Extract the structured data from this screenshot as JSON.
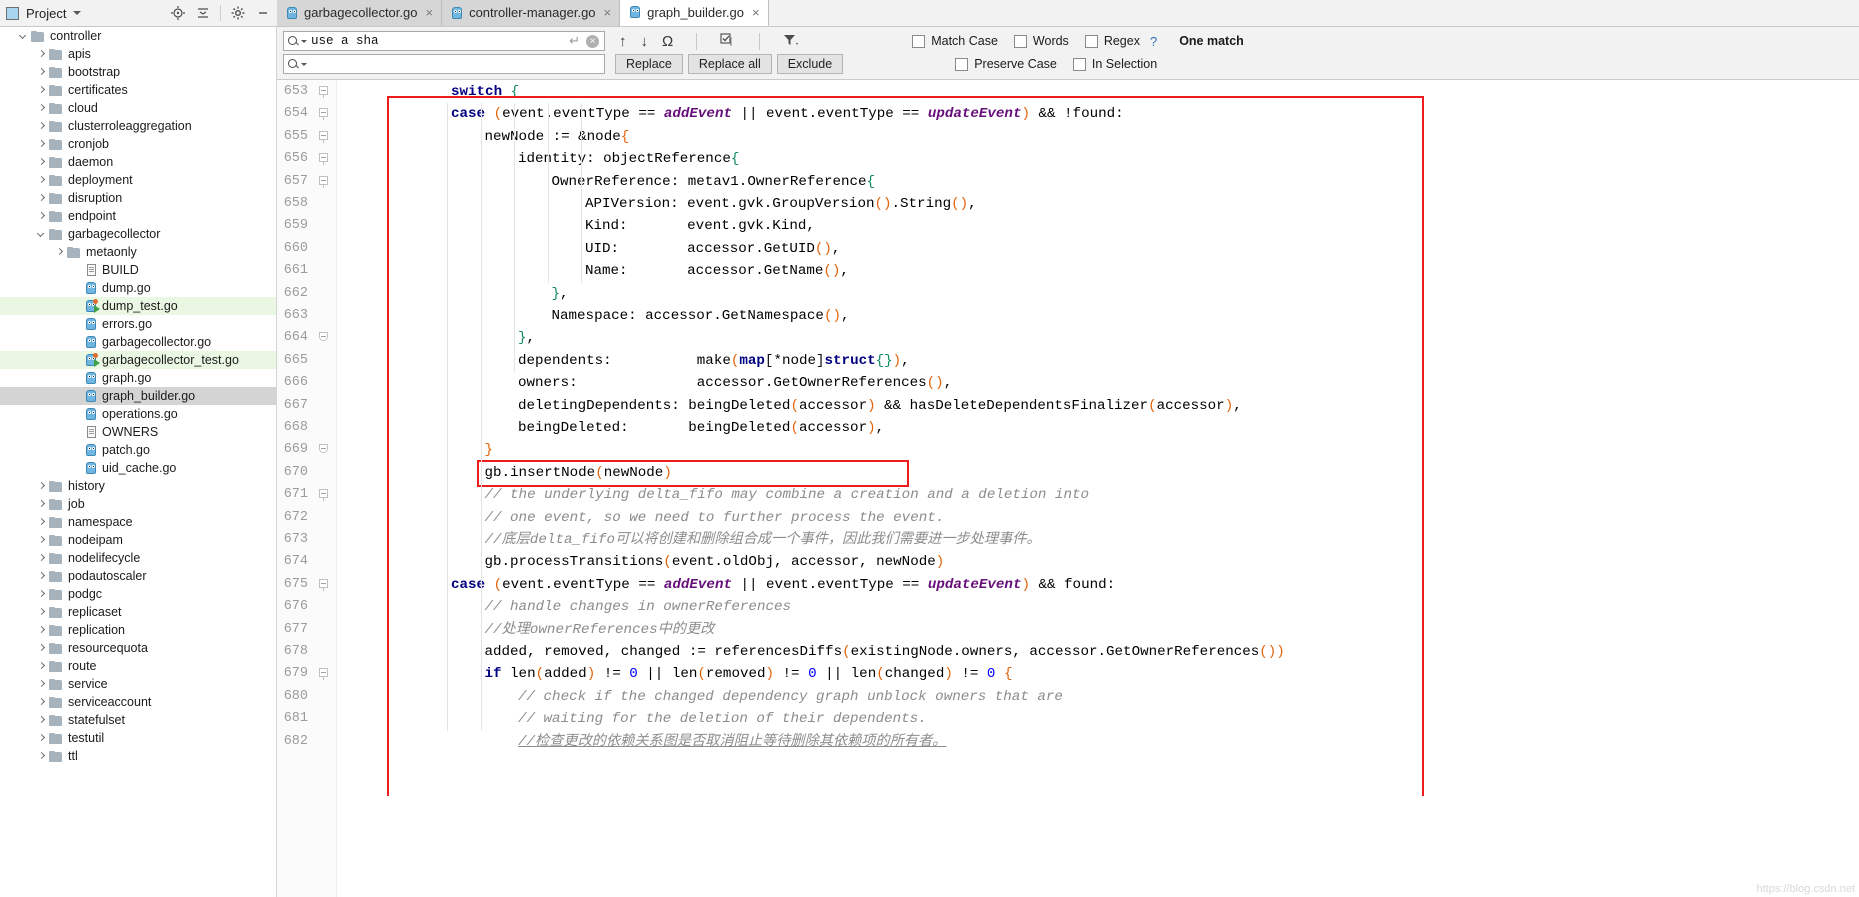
{
  "project_panel": {
    "title": "Project",
    "icon": "project-icon",
    "tools": [
      "locate-icon",
      "collapse-all-icon",
      "settings-gear-icon",
      "minimize-icon"
    ],
    "items": [
      {
        "label": "controller",
        "depth": 1,
        "type": "folder",
        "state": "expanded"
      },
      {
        "label": "apis",
        "depth": 2,
        "type": "folder",
        "state": "collapsed"
      },
      {
        "label": "bootstrap",
        "depth": 2,
        "type": "folder",
        "state": "collapsed"
      },
      {
        "label": "certificates",
        "depth": 2,
        "type": "folder",
        "state": "collapsed"
      },
      {
        "label": "cloud",
        "depth": 2,
        "type": "folder",
        "state": "collapsed"
      },
      {
        "label": "clusterroleaggregation",
        "depth": 2,
        "type": "folder",
        "state": "collapsed"
      },
      {
        "label": "cronjob",
        "depth": 2,
        "type": "folder",
        "state": "collapsed"
      },
      {
        "label": "daemon",
        "depth": 2,
        "type": "folder",
        "state": "collapsed"
      },
      {
        "label": "deployment",
        "depth": 2,
        "type": "folder",
        "state": "collapsed"
      },
      {
        "label": "disruption",
        "depth": 2,
        "type": "folder",
        "state": "collapsed"
      },
      {
        "label": "endpoint",
        "depth": 2,
        "type": "folder",
        "state": "collapsed"
      },
      {
        "label": "garbagecollector",
        "depth": 2,
        "type": "folder",
        "state": "expanded"
      },
      {
        "label": "metaonly",
        "depth": 3,
        "type": "folder",
        "state": "collapsed"
      },
      {
        "label": "BUILD",
        "depth": 4,
        "type": "text"
      },
      {
        "label": "dump.go",
        "depth": 4,
        "type": "go"
      },
      {
        "label": "dump_test.go",
        "depth": 4,
        "type": "gotest",
        "highlight": "green"
      },
      {
        "label": "errors.go",
        "depth": 4,
        "type": "go"
      },
      {
        "label": "garbagecollector.go",
        "depth": 4,
        "type": "go"
      },
      {
        "label": "garbagecollector_test.go",
        "depth": 4,
        "type": "gotest",
        "highlight": "green"
      },
      {
        "label": "graph.go",
        "depth": 4,
        "type": "go"
      },
      {
        "label": "graph_builder.go",
        "depth": 4,
        "type": "go",
        "highlight": "selected"
      },
      {
        "label": "operations.go",
        "depth": 4,
        "type": "go"
      },
      {
        "label": "OWNERS",
        "depth": 4,
        "type": "text"
      },
      {
        "label": "patch.go",
        "depth": 4,
        "type": "go"
      },
      {
        "label": "uid_cache.go",
        "depth": 4,
        "type": "go"
      },
      {
        "label": "history",
        "depth": 2,
        "type": "folder",
        "state": "collapsed"
      },
      {
        "label": "job",
        "depth": 2,
        "type": "folder",
        "state": "collapsed"
      },
      {
        "label": "namespace",
        "depth": 2,
        "type": "folder",
        "state": "collapsed"
      },
      {
        "label": "nodeipam",
        "depth": 2,
        "type": "folder",
        "state": "collapsed"
      },
      {
        "label": "nodelifecycle",
        "depth": 2,
        "type": "folder",
        "state": "collapsed"
      },
      {
        "label": "podautoscaler",
        "depth": 2,
        "type": "folder",
        "state": "collapsed"
      },
      {
        "label": "podgc",
        "depth": 2,
        "type": "folder",
        "state": "collapsed"
      },
      {
        "label": "replicaset",
        "depth": 2,
        "type": "folder",
        "state": "collapsed"
      },
      {
        "label": "replication",
        "depth": 2,
        "type": "folder",
        "state": "collapsed"
      },
      {
        "label": "resourcequota",
        "depth": 2,
        "type": "folder",
        "state": "collapsed"
      },
      {
        "label": "route",
        "depth": 2,
        "type": "folder",
        "state": "collapsed"
      },
      {
        "label": "service",
        "depth": 2,
        "type": "folder",
        "state": "collapsed"
      },
      {
        "label": "serviceaccount",
        "depth": 2,
        "type": "folder",
        "state": "collapsed"
      },
      {
        "label": "statefulset",
        "depth": 2,
        "type": "folder",
        "state": "collapsed"
      },
      {
        "label": "testutil",
        "depth": 2,
        "type": "folder",
        "state": "collapsed"
      },
      {
        "label": "ttl",
        "depth": 2,
        "type": "folder",
        "state": "collapsed"
      }
    ]
  },
  "tabs": [
    {
      "label": "garbagecollector.go",
      "active": false,
      "icon": "go-file-icon",
      "close": "×"
    },
    {
      "label": "controller-manager.go",
      "active": false,
      "icon": "go-file-icon",
      "close": "×"
    },
    {
      "label": "graph_builder.go",
      "active": true,
      "icon": "go-file-icon",
      "close": "×"
    }
  ],
  "find_panel": {
    "search_value": "use a sha",
    "search_placeholder": "",
    "replace_value": "",
    "replace_placeholder": "",
    "enter_icon": "↵",
    "clear_icon": "×",
    "prev_icon": "↑",
    "next_icon": "↓",
    "regex_omega_icon": "Ω",
    "select_all_icon": "select-all-icon",
    "filter_icon": "filter-icon",
    "buttons": [
      "Replace",
      "Replace all",
      "Exclude"
    ],
    "checkboxes_row1": [
      {
        "label": "Match Case",
        "accel": "C",
        "checked": false
      },
      {
        "label": "Words",
        "accel": "o",
        "checked": false
      },
      {
        "label": "Regex",
        "accel": "x",
        "checked": false
      }
    ],
    "checkboxes_row2": [
      {
        "label": "Preserve Case",
        "accel": "",
        "checked": false
      },
      {
        "label": "In Selection",
        "accel": "",
        "checked": false
      }
    ],
    "help_icon": "?",
    "match_info": "One match"
  },
  "editor": {
    "first_line": 653,
    "lines": [
      {
        "n": 653,
        "indent": 0,
        "fold": "start",
        "tokens": [
          {
            "t": "switch ",
            "c": "kw"
          },
          {
            "t": "{",
            "c": "brc"
          }
        ]
      },
      {
        "n": 654,
        "indent": 0,
        "fold": "start",
        "tokens": [
          {
            "t": "case ",
            "c": "kw"
          },
          {
            "t": "(",
            "c": "par"
          },
          {
            "t": "event.eventType == ",
            "c": "ident"
          },
          {
            "t": "addEvent",
            "c": "it"
          },
          {
            "t": " || ",
            "c": "ident"
          },
          {
            "t": "event.eventType == ",
            "c": "ident"
          },
          {
            "t": "updateEvent",
            "c": "it"
          },
          {
            "t": ")",
            "c": "par"
          },
          {
            "t": " && !found:",
            "c": "ident"
          }
        ]
      },
      {
        "n": 655,
        "indent": 1,
        "fold": "start",
        "tokens": [
          {
            "t": "newNode := &node",
            "c": "ident"
          },
          {
            "t": "{",
            "c": "par"
          }
        ]
      },
      {
        "n": 656,
        "indent": 2,
        "fold": "start",
        "tokens": [
          {
            "t": "identity: objectReference",
            "c": "ident"
          },
          {
            "t": "{",
            "c": "brc"
          }
        ]
      },
      {
        "n": 657,
        "indent": 3,
        "fold": "start",
        "tokens": [
          {
            "t": "OwnerReference: metav1.OwnerReference",
            "c": "ident"
          },
          {
            "t": "{",
            "c": "brc"
          }
        ]
      },
      {
        "n": 658,
        "indent": 4,
        "fold": "",
        "tokens": [
          {
            "t": "APIVersion: event.gvk.GroupVersion",
            "c": "ident"
          },
          {
            "t": "()",
            "c": "par"
          },
          {
            "t": ".String",
            "c": "ident"
          },
          {
            "t": "()",
            "c": "par"
          },
          {
            "t": ",",
            "c": "ident"
          }
        ]
      },
      {
        "n": 659,
        "indent": 4,
        "fold": "",
        "tokens": [
          {
            "t": "Kind:       event.gvk.Kind,",
            "c": "ident"
          }
        ]
      },
      {
        "n": 660,
        "indent": 4,
        "fold": "",
        "tokens": [
          {
            "t": "UID:        accessor.GetUID",
            "c": "ident"
          },
          {
            "t": "()",
            "c": "par"
          },
          {
            "t": ",",
            "c": "ident"
          }
        ]
      },
      {
        "n": 661,
        "indent": 4,
        "fold": "",
        "tokens": [
          {
            "t": "Name:       accessor.GetName",
            "c": "ident"
          },
          {
            "t": "()",
            "c": "par"
          },
          {
            "t": ",",
            "c": "ident"
          }
        ]
      },
      {
        "n": 662,
        "indent": 3,
        "fold": "",
        "tokens": [
          {
            "t": "}",
            "c": "brc"
          },
          {
            "t": ",",
            "c": "ident"
          }
        ]
      },
      {
        "n": 663,
        "indent": 3,
        "fold": "",
        "tokens": [
          {
            "t": "Namespace: accessor.GetNamespace",
            "c": "ident"
          },
          {
            "t": "()",
            "c": "par"
          },
          {
            "t": ",",
            "c": "ident"
          }
        ]
      },
      {
        "n": 664,
        "indent": 2,
        "fold": "end",
        "tokens": [
          {
            "t": "}",
            "c": "brc"
          },
          {
            "t": ",",
            "c": "ident"
          }
        ]
      },
      {
        "n": 665,
        "indent": 2,
        "fold": "",
        "tokens": [
          {
            "t": "dependents:          make",
            "c": "ident"
          },
          {
            "t": "(",
            "c": "par"
          },
          {
            "t": "map",
            "c": "kw"
          },
          {
            "t": "[",
            "c": "brk"
          },
          {
            "t": "*node",
            "c": "ident"
          },
          {
            "t": "]",
            "c": "brk"
          },
          {
            "t": "struct",
            "c": "kw"
          },
          {
            "t": "{}",
            "c": "brc"
          },
          {
            "t": ")",
            "c": "par"
          },
          {
            "t": ",",
            "c": "ident"
          }
        ]
      },
      {
        "n": 666,
        "indent": 2,
        "fold": "",
        "tokens": [
          {
            "t": "owners:              accessor.GetOwnerReferences",
            "c": "ident"
          },
          {
            "t": "()",
            "c": "par"
          },
          {
            "t": ",",
            "c": "ident"
          }
        ]
      },
      {
        "n": 667,
        "indent": 2,
        "fold": "",
        "tokens": [
          {
            "t": "deletingDependents: beingDeleted",
            "c": "ident"
          },
          {
            "t": "(",
            "c": "par"
          },
          {
            "t": "accessor",
            "c": "ident"
          },
          {
            "t": ")",
            "c": "par"
          },
          {
            "t": " && hasDeleteDependentsFinalizer",
            "c": "ident"
          },
          {
            "t": "(",
            "c": "par"
          },
          {
            "t": "accessor",
            "c": "ident"
          },
          {
            "t": ")",
            "c": "par"
          },
          {
            "t": ",",
            "c": "ident"
          }
        ]
      },
      {
        "n": 668,
        "indent": 2,
        "fold": "",
        "tokens": [
          {
            "t": "beingDeleted:       beingDeleted",
            "c": "ident"
          },
          {
            "t": "(",
            "c": "par"
          },
          {
            "t": "accessor",
            "c": "ident"
          },
          {
            "t": ")",
            "c": "par"
          },
          {
            "t": ",",
            "c": "ident"
          }
        ]
      },
      {
        "n": 669,
        "indent": 1,
        "fold": "end",
        "tokens": [
          {
            "t": "}",
            "c": "par"
          }
        ]
      },
      {
        "n": 670,
        "indent": 1,
        "fold": "",
        "boxed": true,
        "tokens": [
          {
            "t": "gb.insertNode",
            "c": "ident"
          },
          {
            "t": "(",
            "c": "par"
          },
          {
            "t": "newNode",
            "c": "ident"
          },
          {
            "t": ")",
            "c": "par"
          }
        ]
      },
      {
        "n": 671,
        "indent": 1,
        "fold": "start",
        "tokens": [
          {
            "t": "// the underlying delta_fifo may combine a creation and a deletion into",
            "c": "cmt"
          }
        ]
      },
      {
        "n": 672,
        "indent": 1,
        "fold": "",
        "tokens": [
          {
            "t": "// one event, so we need to further process the event.",
            "c": "cmt"
          }
        ]
      },
      {
        "n": 673,
        "indent": 1,
        "fold": "",
        "tokens": [
          {
            "t": "//底层delta_fifo可以将创建和删除组合成一个事件，因此我们需要进一步处理事件。",
            "c": "cmt"
          }
        ]
      },
      {
        "n": 674,
        "indent": 1,
        "fold": "",
        "tokens": [
          {
            "t": "gb.processTransitions",
            "c": "ident"
          },
          {
            "t": "(",
            "c": "par"
          },
          {
            "t": "event.oldObj, accessor, newNode",
            "c": "ident"
          },
          {
            "t": ")",
            "c": "par"
          }
        ]
      },
      {
        "n": 675,
        "indent": 0,
        "fold": "start",
        "tokens": [
          {
            "t": "case ",
            "c": "kw"
          },
          {
            "t": "(",
            "c": "par"
          },
          {
            "t": "event.eventType == ",
            "c": "ident"
          },
          {
            "t": "addEvent",
            "c": "it"
          },
          {
            "t": " || ",
            "c": "ident"
          },
          {
            "t": "event.eventType == ",
            "c": "ident"
          },
          {
            "t": "updateEvent",
            "c": "it"
          },
          {
            "t": ")",
            "c": "par"
          },
          {
            "t": " && found:",
            "c": "ident"
          }
        ]
      },
      {
        "n": 676,
        "indent": 1,
        "fold": "",
        "tokens": [
          {
            "t": "// handle changes in ownerReferences",
            "c": "cmt"
          }
        ]
      },
      {
        "n": 677,
        "indent": 1,
        "fold": "",
        "tokens": [
          {
            "t": "//处理ownerReferences中的更改",
            "c": "cmt"
          }
        ]
      },
      {
        "n": 678,
        "indent": 1,
        "fold": "",
        "tokens": [
          {
            "t": "added, removed, changed := referencesDiffs",
            "c": "ident"
          },
          {
            "t": "(",
            "c": "par"
          },
          {
            "t": "existingNode.owners, accessor.GetOwnerReferences",
            "c": "ident"
          },
          {
            "t": "())",
            "c": "par"
          }
        ]
      },
      {
        "n": 679,
        "indent": 1,
        "fold": "start",
        "tokens": [
          {
            "t": "if ",
            "c": "kw"
          },
          {
            "t": "len",
            "c": "ident"
          },
          {
            "t": "(",
            "c": "par"
          },
          {
            "t": "added",
            "c": "ident"
          },
          {
            "t": ")",
            "c": "par"
          },
          {
            "t": " != ",
            "c": "ident"
          },
          {
            "t": "0",
            "c": "num"
          },
          {
            "t": " || ",
            "c": "ident"
          },
          {
            "t": "len",
            "c": "ident"
          },
          {
            "t": "(",
            "c": "par"
          },
          {
            "t": "removed",
            "c": "ident"
          },
          {
            "t": ")",
            "c": "par"
          },
          {
            "t": " != ",
            "c": "ident"
          },
          {
            "t": "0",
            "c": "num"
          },
          {
            "t": " || ",
            "c": "ident"
          },
          {
            "t": "len",
            "c": "ident"
          },
          {
            "t": "(",
            "c": "par"
          },
          {
            "t": "changed",
            "c": "ident"
          },
          {
            "t": ")",
            "c": "par"
          },
          {
            "t": " != ",
            "c": "ident"
          },
          {
            "t": "0",
            "c": "num"
          },
          {
            "t": " ",
            "c": "ident"
          },
          {
            "t": "{",
            "c": "par"
          }
        ]
      },
      {
        "n": 680,
        "indent": 2,
        "fold": "",
        "tokens": [
          {
            "t": "// check if the changed dependency graph unblock owners that are",
            "c": "cmt"
          }
        ]
      },
      {
        "n": 681,
        "indent": 2,
        "fold": "",
        "tokens": [
          {
            "t": "// waiting for the deletion of their dependents.",
            "c": "cmt"
          }
        ]
      },
      {
        "n": 682,
        "indent": 2,
        "fold": "",
        "tokens": [
          {
            "t": "//检查更改的依赖关系图是否取消阻止等待删除其依赖项的所有者。",
            "c": "cmt-u"
          }
        ]
      }
    ]
  },
  "annotations": {
    "outer_box": "red-outline-main",
    "inner_box": "red-outline-insertnode"
  },
  "watermark": "https://blog.csdn.net"
}
